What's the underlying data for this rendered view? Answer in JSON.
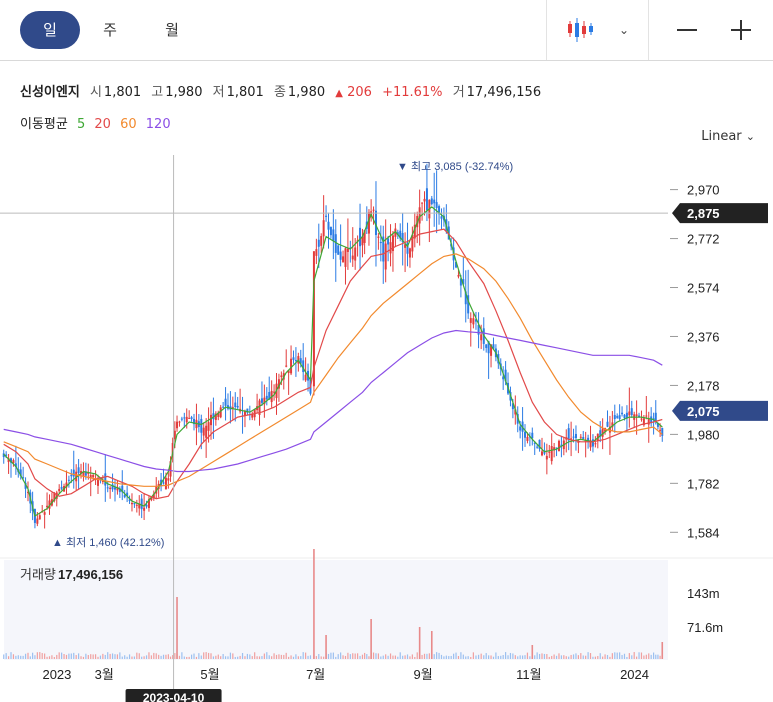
{
  "tabs": [
    {
      "label": "일",
      "active": true
    },
    {
      "label": "주",
      "active": false
    },
    {
      "label": "월",
      "active": false
    }
  ],
  "quote": {
    "name": "신성이엔지",
    "open_label": "시",
    "open": "1,801",
    "high_label": "고",
    "high": "1,980",
    "low_label": "저",
    "low": "1,801",
    "close_label": "종",
    "close": "1,980",
    "change_arrow": "▲",
    "change": "206",
    "change_pct": "+11.61%",
    "volume_label": "거",
    "volume": "17,496,156"
  },
  "moving_average": {
    "label": "이동평균",
    "periods": [
      {
        "label": "5",
        "color": "#3fa835"
      },
      {
        "label": "20",
        "color": "#e24a4a"
      },
      {
        "label": "60",
        "color": "#f28a2e"
      },
      {
        "label": "120",
        "color": "#8b4fe6"
      }
    ]
  },
  "scale_label": "Linear",
  "colors": {
    "up": "#e23b3b",
    "down": "#2a7be4",
    "accent": "#304a8a"
  },
  "chart_data": {
    "type": "candlestick",
    "x_ticks": [
      "2023",
      "3월",
      "5월",
      "7월",
      "9월",
      "11월",
      "2024"
    ],
    "y_ticks": [
      2970,
      2772,
      2574,
      2376,
      2178,
      1980,
      1782,
      1584
    ],
    "ylim": [
      1480,
      3110
    ],
    "crosshair": {
      "price_label": "2,875",
      "price": 2875,
      "date_label": "2023-04-10"
    },
    "last_price": {
      "label": "2,075",
      "price": 2075
    },
    "high_annotation": {
      "text": "▼ 최고  3,085 (-32.74%)",
      "price": 3085
    },
    "low_annotation": {
      "text": "▲ 최저  1,460 (42.12%)",
      "price": 1460
    },
    "close_trace": [
      {
        "d": "2023-01-02",
        "c": 1900
      },
      {
        "d": "2023-01-09",
        "c": 1860
      },
      {
        "d": "2023-01-16",
        "c": 1750
      },
      {
        "d": "2023-01-20",
        "c": 1620
      },
      {
        "d": "2023-01-27",
        "c": 1700
      },
      {
        "d": "2023-02-03",
        "c": 1760
      },
      {
        "d": "2023-02-10",
        "c": 1800
      },
      {
        "d": "2023-02-17",
        "c": 1840
      },
      {
        "d": "2023-02-24",
        "c": 1810
      },
      {
        "d": "2023-03-03",
        "c": 1770
      },
      {
        "d": "2023-03-10",
        "c": 1760
      },
      {
        "d": "2023-03-17",
        "c": 1700
      },
      {
        "d": "2023-03-24",
        "c": 1690
      },
      {
        "d": "2023-03-31",
        "c": 1760
      },
      {
        "d": "2023-04-07",
        "c": 1820
      },
      {
        "d": "2023-04-12",
        "c": 2030
      },
      {
        "d": "2023-04-19",
        "c": 2050
      },
      {
        "d": "2023-04-26",
        "c": 2000
      },
      {
        "d": "2023-05-03",
        "c": 2060
      },
      {
        "d": "2023-05-10",
        "c": 2100
      },
      {
        "d": "2023-05-17",
        "c": 2080
      },
      {
        "d": "2023-05-24",
        "c": 2060
      },
      {
        "d": "2023-05-31",
        "c": 2110
      },
      {
        "d": "2023-06-07",
        "c": 2150
      },
      {
        "d": "2023-06-14",
        "c": 2250
      },
      {
        "d": "2023-06-21",
        "c": 2300
      },
      {
        "d": "2023-06-28",
        "c": 2150
      },
      {
        "d": "2023-06-30",
        "c": 2700
      },
      {
        "d": "2023-07-07",
        "c": 2850
      },
      {
        "d": "2023-07-14",
        "c": 2700
      },
      {
        "d": "2023-07-21",
        "c": 2720
      },
      {
        "d": "2023-07-28",
        "c": 2780
      },
      {
        "d": "2023-08-02",
        "c": 2900
      },
      {
        "d": "2023-08-09",
        "c": 2700
      },
      {
        "d": "2023-08-16",
        "c": 2820
      },
      {
        "d": "2023-08-23",
        "c": 2700
      },
      {
        "d": "2023-08-30",
        "c": 2900
      },
      {
        "d": "2023-09-06",
        "c": 2920
      },
      {
        "d": "2023-09-13",
        "c": 2850
      },
      {
        "d": "2023-09-20",
        "c": 2650
      },
      {
        "d": "2023-09-27",
        "c": 2500
      },
      {
        "d": "2023-10-06",
        "c": 2350
      },
      {
        "d": "2023-10-13",
        "c": 2300
      },
      {
        "d": "2023-10-20",
        "c": 2150
      },
      {
        "d": "2023-10-27",
        "c": 2000
      },
      {
        "d": "2023-11-03",
        "c": 1950
      },
      {
        "d": "2023-11-10",
        "c": 1900
      },
      {
        "d": "2023-11-17",
        "c": 1930
      },
      {
        "d": "2023-11-24",
        "c": 1960
      },
      {
        "d": "2023-12-01",
        "c": 1960
      },
      {
        "d": "2023-12-08",
        "c": 1940
      },
      {
        "d": "2023-12-15",
        "c": 2000
      },
      {
        "d": "2023-12-22",
        "c": 2040
      },
      {
        "d": "2023-12-29",
        "c": 2060
      },
      {
        "d": "2024-01-05",
        "c": 2050
      },
      {
        "d": "2024-01-12",
        "c": 2030
      },
      {
        "d": "2024-01-17",
        "c": 1980
      }
    ],
    "ma": {
      "5": [
        1900,
        1850,
        1760,
        1650,
        1680,
        1740,
        1790,
        1830,
        1820,
        1780,
        1760,
        1710,
        1690,
        1750,
        1830,
        1980,
        2030,
        2020,
        2050,
        2090,
        2080,
        2070,
        2100,
        2140,
        2230,
        2280,
        2200,
        2600,
        2780,
        2750,
        2730,
        2780,
        2870,
        2760,
        2800,
        2740,
        2860,
        2900,
        2860,
        2680,
        2520,
        2380,
        2310,
        2170,
        2020,
        1960,
        1910,
        1920,
        1950,
        1960,
        1950,
        1990,
        2030,
        2050,
        2050,
        2040,
        2010
      ],
      "20": [
        1940,
        1910,
        1860,
        1800,
        1760,
        1730,
        1740,
        1770,
        1800,
        1810,
        1790,
        1770,
        1740,
        1720,
        1730,
        1790,
        1860,
        1940,
        1990,
        2020,
        2050,
        2060,
        2070,
        2090,
        2120,
        2150,
        2170,
        2250,
        2400,
        2500,
        2600,
        2660,
        2700,
        2710,
        2740,
        2760,
        2790,
        2800,
        2810,
        2760,
        2680,
        2590,
        2480,
        2360,
        2230,
        2110,
        2030,
        1980,
        1960,
        1950,
        1950,
        1960,
        1980,
        2000,
        2020,
        2030,
        2040
      ],
      "60": [
        1950,
        1930,
        1910,
        1880,
        1860,
        1840,
        1820,
        1810,
        1800,
        1790,
        1780,
        1775,
        1770,
        1770,
        1775,
        1790,
        1810,
        1840,
        1870,
        1900,
        1930,
        1960,
        1990,
        2020,
        2050,
        2080,
        2110,
        2150,
        2220,
        2290,
        2350,
        2410,
        2460,
        2510,
        2550,
        2590,
        2630,
        2670,
        2700,
        2710,
        2690,
        2650,
        2600,
        2530,
        2450,
        2360,
        2280,
        2200,
        2130,
        2070,
        2030,
        2000,
        1990,
        1990,
        2000,
        2010,
        1980
      ],
      "120": [
        2000,
        1990,
        1980,
        1970,
        1960,
        1950,
        1940,
        1925,
        1910,
        1895,
        1880,
        1865,
        1850,
        1840,
        1835,
        1830,
        1830,
        1835,
        1840,
        1850,
        1860,
        1875,
        1890,
        1905,
        1920,
        1940,
        1960,
        1990,
        2030,
        2070,
        2110,
        2150,
        2190,
        2230,
        2270,
        2310,
        2340,
        2370,
        2390,
        2400,
        2395,
        2390,
        2380,
        2370,
        2360,
        2350,
        2340,
        2330,
        2320,
        2310,
        2300,
        2300,
        2300,
        2300,
        2290,
        2280,
        2260
      ]
    },
    "volume": {
      "label": "거래량",
      "value": "17,496,156",
      "y_ticks": [
        "143m",
        "71.6m"
      ],
      "peaks": [
        {
          "d": "2023-04-12",
          "v": 62
        },
        {
          "d": "2023-06-30",
          "v": 110
        },
        {
          "d": "2023-07-07",
          "v": 24
        },
        {
          "d": "2023-08-02",
          "v": 40
        },
        {
          "d": "2023-08-30",
          "v": 32
        },
        {
          "d": "2023-09-06",
          "v": 28
        },
        {
          "d": "2023-11-03",
          "v": 14
        },
        {
          "d": "2024-01-17",
          "v": 17
        }
      ]
    }
  }
}
